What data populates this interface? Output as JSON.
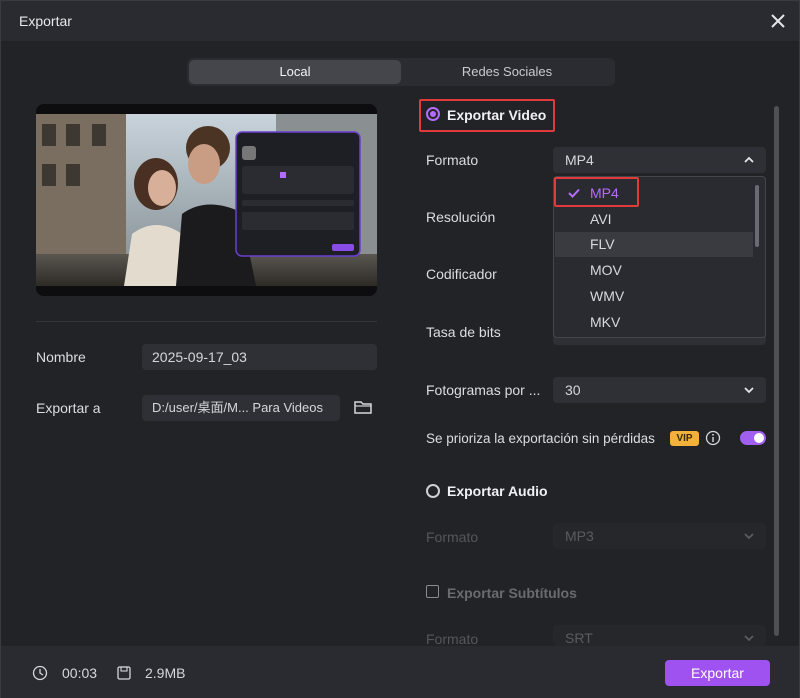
{
  "window": {
    "title": "Exportar"
  },
  "tabs": [
    {
      "label": "Local",
      "active": true
    },
    {
      "label": "Redes Sociales",
      "active": false
    }
  ],
  "left": {
    "name_label": "Nombre",
    "name_value": "2025-09-17_03",
    "export_to_label": "Exportar a",
    "export_to_value": "D:/user/桌面/M... Para Videos"
  },
  "video": {
    "title": "Exportar Video",
    "selected": true,
    "format_label": "Formato",
    "format_value": "MP4",
    "resolution_label": "Resolución",
    "encoder_label": "Codificador",
    "bitrate_label": "Tasa de bits",
    "fps_label": "Fotogramas por ...",
    "fps_value": "30",
    "lossless_label": "Se prioriza la exportación sin pérdidas",
    "vip_badge": "VIP",
    "lossless_enabled": true
  },
  "format_menu": {
    "options": [
      "MP4",
      "AVI",
      "FLV",
      "MOV",
      "WMV",
      "MKV"
    ],
    "selected": "MP4",
    "hovered": "FLV"
  },
  "audio": {
    "title": "Exportar Audio",
    "selected": false,
    "format_label": "Formato",
    "format_value": "MP3"
  },
  "subtitles": {
    "title": "Exportar Subtítulos",
    "checked": false,
    "format_label": "Formato",
    "format_value": "SRT"
  },
  "footer": {
    "duration": "00:03",
    "size": "2.9MB",
    "export_label": "Exportar"
  },
  "colors": {
    "accent": "#a052f0",
    "highlight": "#e03a3a",
    "vip": "#f2b13a"
  }
}
